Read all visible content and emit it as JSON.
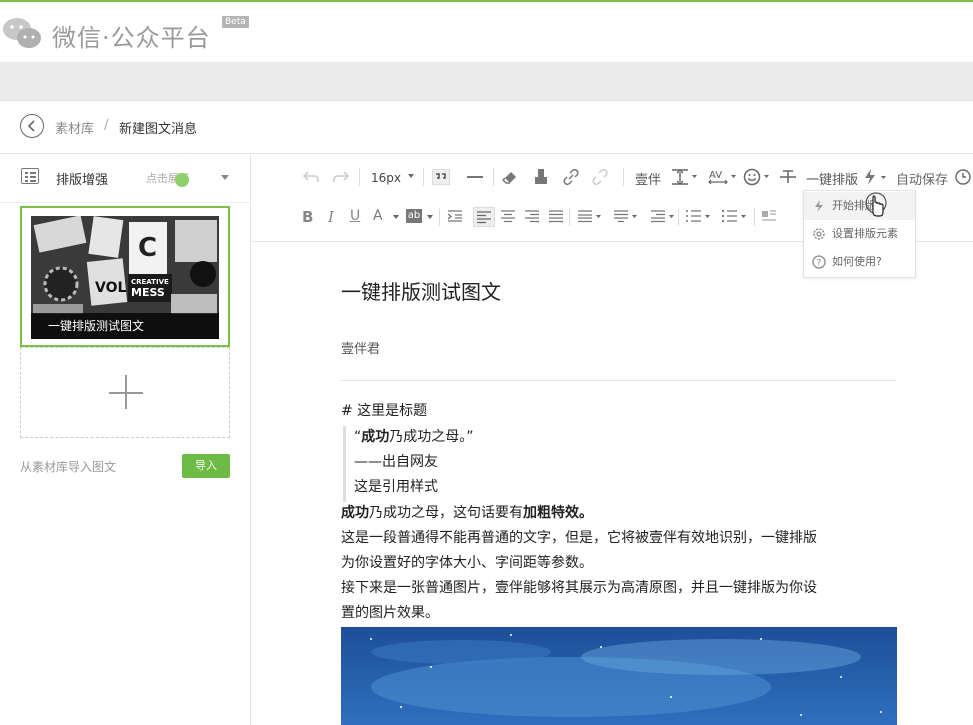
{
  "app": {
    "logo_text": "微信·公众平台",
    "beta": "Beta"
  },
  "breadcrumb": {
    "parent": "素材库",
    "separator": "/",
    "current": "新建图文消息"
  },
  "left_panel": {
    "title": "排版增强",
    "hint": "点击展开",
    "card_caption": "一键排版测试图文",
    "cover_image_words": [
      "C",
      "CREATIVE",
      "MESS",
      "VOL"
    ],
    "import_text": "从素材库导入图文",
    "import_button": "导入"
  },
  "toolbar": {
    "font_size": "16px",
    "brand": "壹伴",
    "format_label": "一键排版",
    "autosave": "自动保存"
  },
  "format_menu": {
    "items": [
      {
        "label": "开始排版",
        "icon": "lightning-icon"
      },
      {
        "label": "设置排版元素",
        "icon": "gear-icon"
      },
      {
        "label": "如何使用?",
        "icon": "help-icon"
      }
    ]
  },
  "article": {
    "title": "一键排版测试图文",
    "author": "壹伴君",
    "heading": "# 这里是标题",
    "quote_open": "“",
    "quote_bold": "成功",
    "quote_rest": "乃成功之母。”",
    "quote_source": "——出自网友",
    "quote_note": "这是引用样式",
    "p1_bold1": "成功",
    "p1_mid": "乃成功之母，这句话要有",
    "p1_bold2": "加粗特效。",
    "p2_line1": "这是一段普通得不能再普通的文字，但是，它将被壹伴有效地识别，一键排版",
    "p2_line2": "为你设置好的字体大小、字间距等参数。",
    "p3_line1": "接下来是一张普通图片，壹伴能够将其展示为高清原图，并且一键排版为你设",
    "p3_line2": "置的图片效果。"
  },
  "colors": {
    "accent_green": "#7ac143",
    "button_green": "#6dba45"
  }
}
